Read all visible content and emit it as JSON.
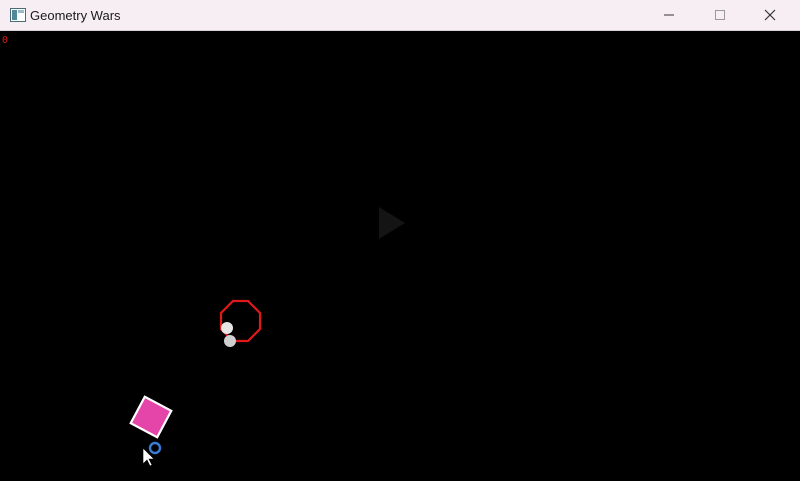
{
  "window": {
    "title": "Geometry Wars",
    "controls": [
      "minimize-icon",
      "maximize-icon",
      "close-icon"
    ]
  },
  "game": {
    "score": "0",
    "colors": {
      "background": "#000000",
      "score_text": "#e01818",
      "enemy_outline": "#e01818",
      "bullet": "#e6e6e6",
      "player_fill": "#e545a8",
      "player_outline": "#ffffff",
      "cursor_ring": "#3a7bd5"
    },
    "icons": [
      "play-overlay-icon",
      "mouse-pointer-icon"
    ]
  }
}
